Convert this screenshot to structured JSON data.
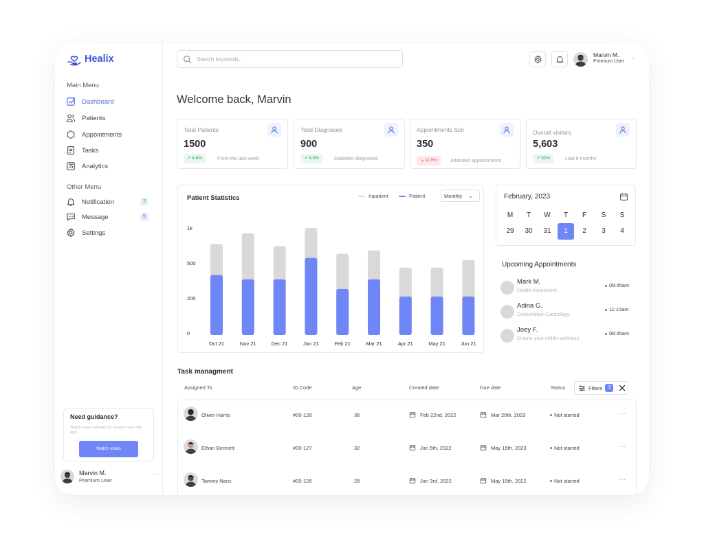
{
  "brand": {
    "name": "Healix",
    "accent": "#3c55d8"
  },
  "sidebar": {
    "main_label": "Main Menu",
    "main_items": [
      {
        "label": "Dashboard",
        "icon": "dashboard-icon",
        "active": true
      },
      {
        "label": "Patients",
        "icon": "patients-icon"
      },
      {
        "label": "Appointments",
        "icon": "appointments-icon"
      },
      {
        "label": "Tasks",
        "icon": "tasks-icon"
      },
      {
        "label": "Analytics",
        "icon": "analytics-icon"
      }
    ],
    "other_label": "Other Menu",
    "other_items": [
      {
        "label": "Notification",
        "icon": "bell-icon",
        "badge": "3"
      },
      {
        "label": "Message",
        "icon": "message-icon",
        "badge": "5"
      },
      {
        "label": "Settings",
        "icon": "gear-icon"
      }
    ],
    "guide": {
      "title": "Need guidance?",
      "text": "Watch video tutorials to receive help with app.",
      "button": "Watch video"
    },
    "user": {
      "name": "Marvin M.",
      "role": "Premium User",
      "more": "···"
    }
  },
  "header": {
    "search_placeholder": "Search keywords...",
    "user": {
      "name": "Marvin M.",
      "role": "Premium User",
      "chevron": "⌄"
    }
  },
  "welcome": "Welcome back, Marvin",
  "stats": [
    {
      "label": "Total Patients",
      "value": "1500",
      "trend": "4.6%",
      "trend_dir": "up",
      "note": "From the last week"
    },
    {
      "label": "Total Diagnoses",
      "value": "900",
      "trend": "4.5%",
      "trend_dir": "up",
      "note": "Diabetes diagnosed"
    },
    {
      "label": "Appointments Sch",
      "value": "350",
      "trend": "11.6%",
      "trend_dir": "down",
      "note": "Attended appointments"
    },
    {
      "label": "Overall visitors",
      "value": "5,603",
      "trend": "52%",
      "trend_dir": "up",
      "note": "Last 6 months"
    }
  ],
  "chart": {
    "title": "Patient Statistics",
    "period": "Monthly",
    "period_chevron": "⌄"
  },
  "chart_data": {
    "type": "bar",
    "title": "Patient Statistics",
    "categories": [
      "Oct 21",
      "Nov 21",
      "Dec 21",
      "Jan 21",
      "Feb 21",
      "Mar 21",
      "Apr 21",
      "May 21",
      "Jun 21"
    ],
    "yticks": [
      "1k",
      "500",
      "200",
      "0"
    ],
    "series": [
      {
        "name": "Inpatient",
        "color": "#d9d9d9",
        "values": [
          850,
          950,
          830,
          1000,
          760,
          790,
          630,
          630,
          700
        ]
      },
      {
        "name": "Patient",
        "color": "#6f86f6",
        "values": [
          560,
          520,
          520,
          720,
          430,
          520,
          360,
          360,
          360
        ]
      }
    ],
    "ylim": [
      0,
      1000
    ],
    "stacked": false,
    "grid": false,
    "legend": "top-right"
  },
  "calendar": {
    "month": "February, 2023",
    "dow": [
      "M",
      "T",
      "W",
      "T",
      "F",
      "S",
      "S"
    ],
    "days": [
      "29",
      "30",
      "31",
      "1",
      "2",
      "3",
      "4"
    ],
    "selected": "1"
  },
  "upcoming": {
    "title": "Upcoming Appointments",
    "items": [
      {
        "name": "Mark M.",
        "sub": "Health Assesment",
        "time": "08:45am"
      },
      {
        "name": "Adina G.",
        "sub": "Consultation Cardiology",
        "time": "11:15am"
      },
      {
        "name": "Joey F.",
        "sub": "Ensure your child's wellness.",
        "time": "08:45am"
      }
    ]
  },
  "tasks": {
    "title": "Task managment",
    "headers": [
      "Assigned To",
      "ID Code",
      "Age",
      "Created date",
      "Due date",
      "Status"
    ],
    "filter_label": "Filters",
    "filter_count": "3",
    "rows": [
      {
        "name": "Oliver Harris",
        "id": "#00-128",
        "age": "36",
        "created": "Feb 22nd, 2022",
        "due": "Mar 20th, 2023",
        "status": "Not started",
        "more": "···"
      },
      {
        "name": "Ethan Bennett",
        "id": "#00-127",
        "age": "32",
        "created": "Jan 5th, 2022",
        "due": "May 15th, 2023",
        "status": "Not started",
        "more": "···"
      },
      {
        "name": "Tammy Nanc",
        "id": "#00-126",
        "age": "28",
        "created": "Jan 3rd, 2022",
        "due": "May 15th, 2022",
        "status": "Not started",
        "more": "···"
      }
    ]
  }
}
